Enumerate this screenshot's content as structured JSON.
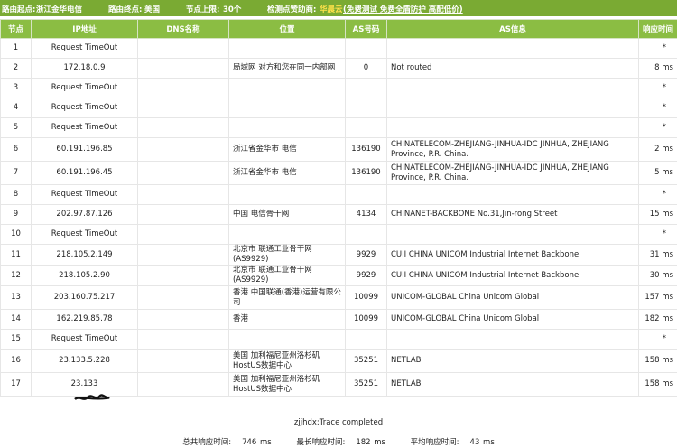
{
  "topbar": {
    "start_label": "路由起点:",
    "start_value": "浙江金华电信",
    "end_label": "路由终点:",
    "end_value": "美国",
    "hops_label": "节点上限:",
    "hops_value": "30个",
    "sponsor_label": "检测点赞助商:",
    "sponsor_name": "华晨云",
    "sponsor_links": "(免费测试 免费全盾防护 高配低价)"
  },
  "table": {
    "headers": [
      "节点",
      "IP地址",
      "DNS名称",
      "位置",
      "AS号码",
      "AS信息",
      "响应时间"
    ],
    "rows": [
      {
        "hop": "1",
        "ip": "Request TimeOut",
        "dns": "",
        "loc": "",
        "asn": "",
        "asinfo": "",
        "time": "*"
      },
      {
        "hop": "2",
        "ip": "172.18.0.9",
        "dns": "",
        "loc": "局域网 对方和您在同一内部网",
        "asn": "0",
        "asinfo": "Not routed",
        "time": "8 ms"
      },
      {
        "hop": "3",
        "ip": "Request TimeOut",
        "dns": "",
        "loc": "",
        "asn": "",
        "asinfo": "",
        "time": "*"
      },
      {
        "hop": "4",
        "ip": "Request TimeOut",
        "dns": "",
        "loc": "",
        "asn": "",
        "asinfo": "",
        "time": "*"
      },
      {
        "hop": "5",
        "ip": "Request TimeOut",
        "dns": "",
        "loc": "",
        "asn": "",
        "asinfo": "",
        "time": "*"
      },
      {
        "hop": "6",
        "ip": "60.191.196.85",
        "dns": "",
        "loc": "浙江省金华市 电信",
        "asn": "136190",
        "asinfo": "CHINATELECOM-ZHEJIANG-JINHUA-IDC JINHUA, ZHEJIANG Province, P.R. China.",
        "time": "2 ms"
      },
      {
        "hop": "7",
        "ip": "60.191.196.45",
        "dns": "",
        "loc": "浙江省金华市 电信",
        "asn": "136190",
        "asinfo": "CHINATELECOM-ZHEJIANG-JINHUA-IDC JINHUA, ZHEJIANG Province, P.R. China.",
        "time": "5 ms"
      },
      {
        "hop": "8",
        "ip": "Request TimeOut",
        "dns": "",
        "loc": "",
        "asn": "",
        "asinfo": "",
        "time": "*"
      },
      {
        "hop": "9",
        "ip": "202.97.87.126",
        "dns": "",
        "loc": "中国 电信骨干网",
        "asn": "4134",
        "asinfo": "CHINANET-BACKBONE No.31,Jin-rong Street",
        "time": "15 ms"
      },
      {
        "hop": "10",
        "ip": "Request TimeOut",
        "dns": "",
        "loc": "",
        "asn": "",
        "asinfo": "",
        "time": "*"
      },
      {
        "hop": "11",
        "ip": "218.105.2.149",
        "dns": "",
        "loc": "北京市 联通工业骨干网(AS9929)",
        "asn": "9929",
        "asinfo": "CUII CHINA UNICOM Industrial Internet Backbone",
        "time": "31 ms"
      },
      {
        "hop": "12",
        "ip": "218.105.2.90",
        "dns": "",
        "loc": "北京市 联通工业骨干网(AS9929)",
        "asn": "9929",
        "asinfo": "CUII CHINA UNICOM Industrial Internet Backbone",
        "time": "30 ms"
      },
      {
        "hop": "13",
        "ip": "203.160.75.217",
        "dns": "",
        "loc": "香港 中国联通(香港)运营有限公司",
        "asn": "10099",
        "asinfo": "UNICOM-GLOBAL China Unicom Global",
        "time": "157 ms"
      },
      {
        "hop": "14",
        "ip": "162.219.85.78",
        "dns": "",
        "loc": "香港",
        "asn": "10099",
        "asinfo": "UNICOM-GLOBAL China Unicom Global",
        "time": "182 ms"
      },
      {
        "hop": "15",
        "ip": "Request TimeOut",
        "dns": "",
        "loc": "",
        "asn": "",
        "asinfo": "",
        "time": "*"
      },
      {
        "hop": "16",
        "ip": "23.133.5.228",
        "dns": "",
        "loc": "美国 加利福尼亚州洛杉矶HostUS数据中心",
        "asn": "35251",
        "asinfo": "NETLAB",
        "time": "158 ms"
      },
      {
        "hop": "17",
        "ip": "23.133",
        "dns": "",
        "loc": "美国 加利福尼亚州洛杉矶HostUS数据中心",
        "asn": "35251",
        "asinfo": "NETLAB",
        "time": "158 ms"
      }
    ]
  },
  "complete_text": "zjjhdx:Trace completed",
  "summary": {
    "total_label": "总共响应时间:",
    "total_value": "746 ms",
    "max_label": "最长响应时间:",
    "max_value": "182 ms",
    "avg_label": "平均响应时间:",
    "avg_value": "43 ms"
  }
}
